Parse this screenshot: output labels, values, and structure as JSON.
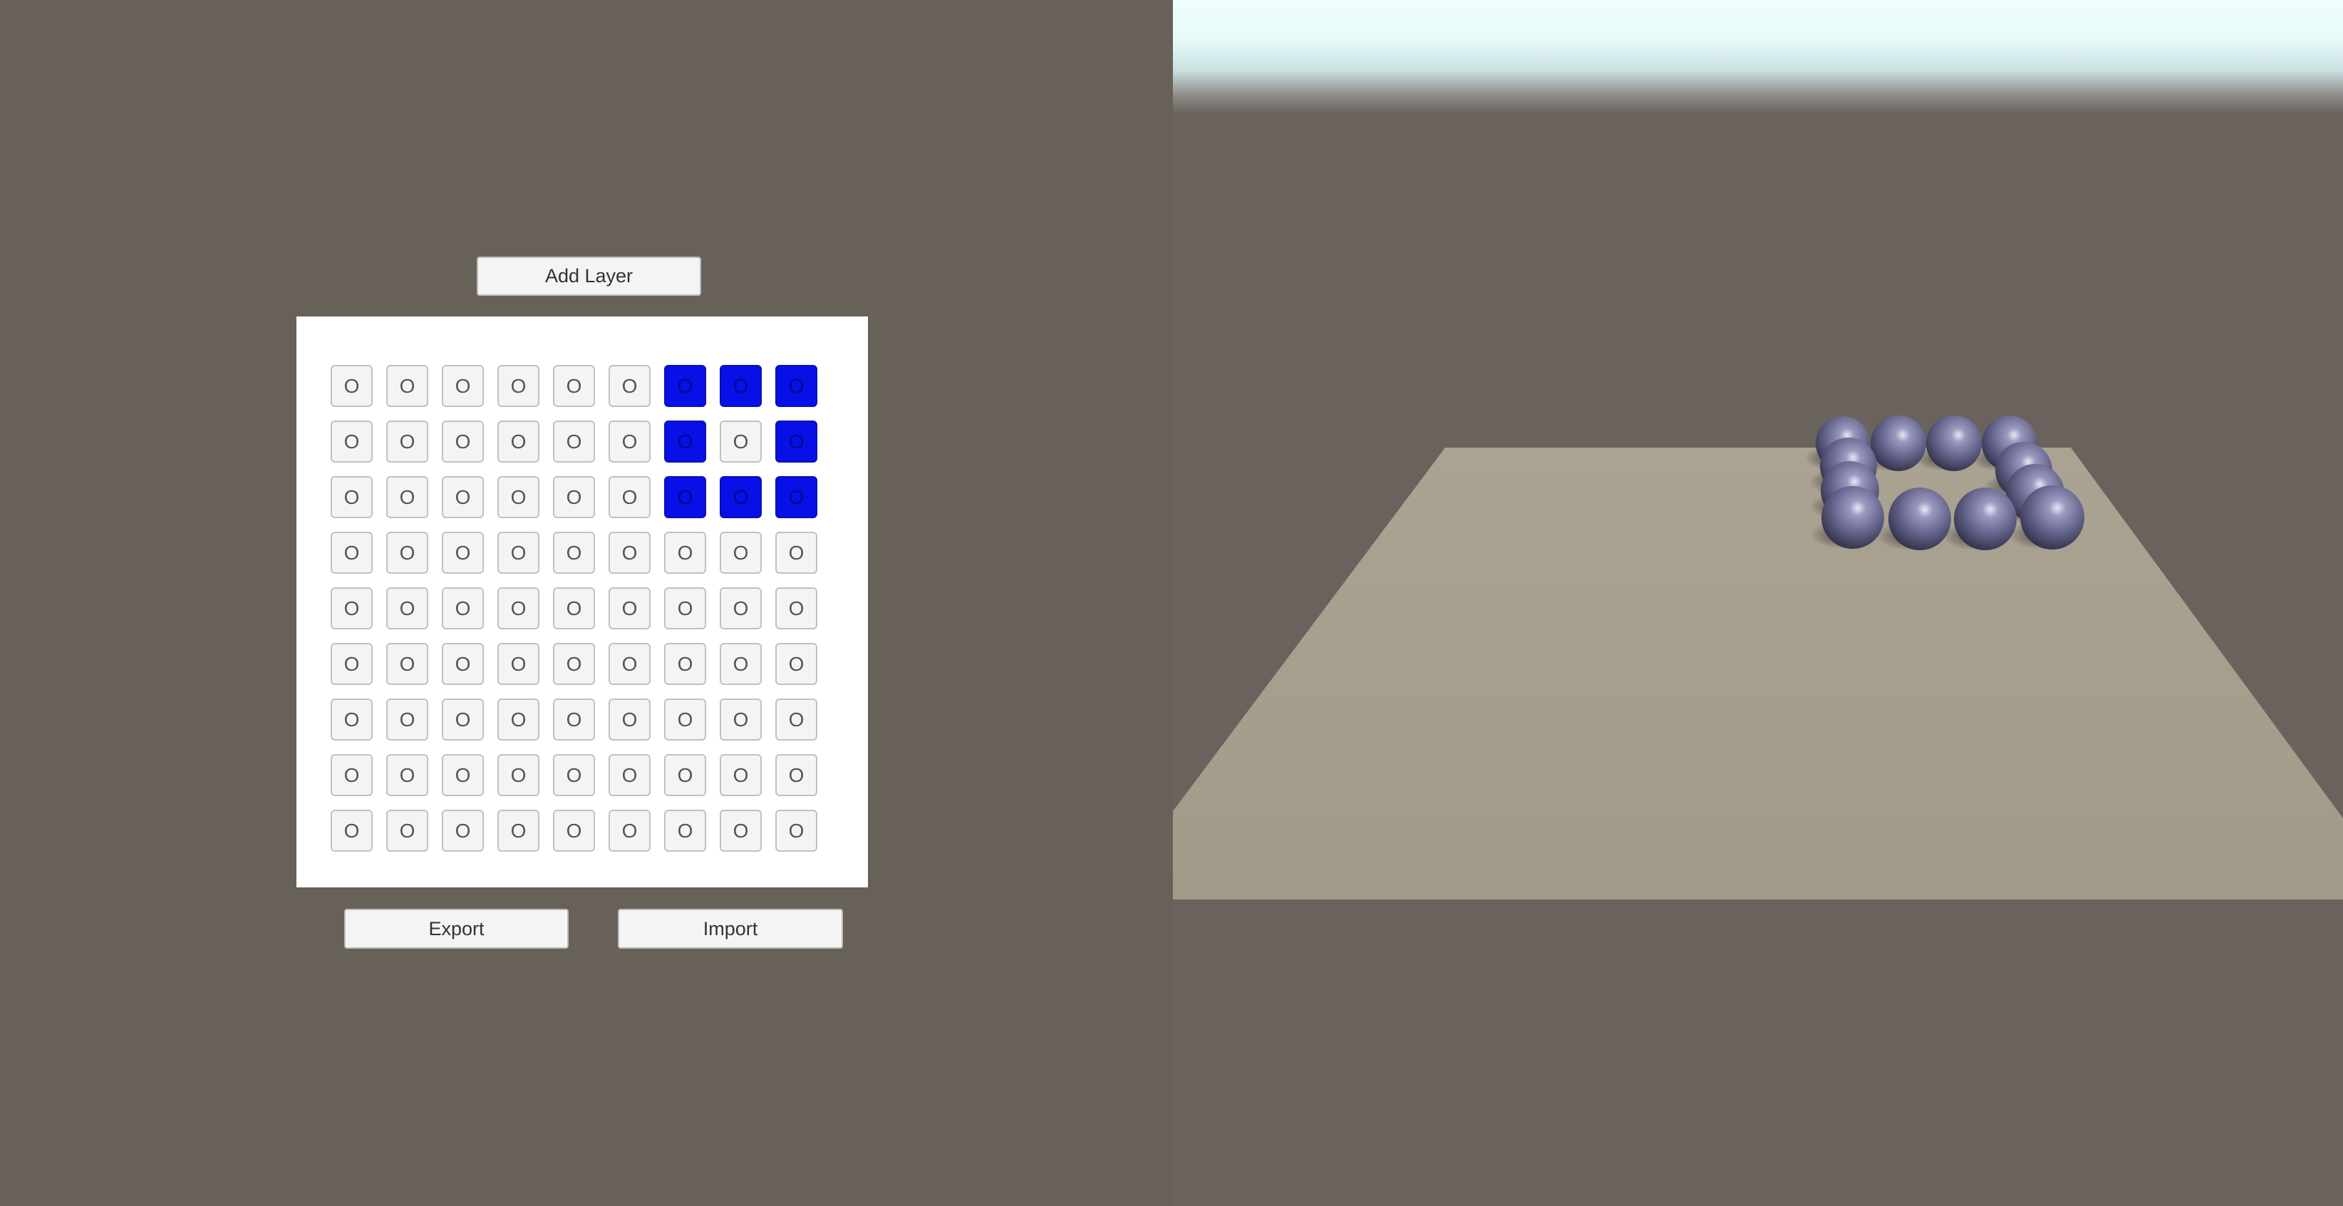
{
  "editor": {
    "add_layer_label": "Add Layer",
    "export_label": "Export",
    "import_label": "Import",
    "cell_glyph": "O",
    "rows": 9,
    "cols": 9,
    "active_color": "#0710e6",
    "active_cells": [
      [
        0,
        6
      ],
      [
        0,
        7
      ],
      [
        0,
        8
      ],
      [
        1,
        6
      ],
      [
        1,
        8
      ],
      [
        2,
        6
      ],
      [
        2,
        7
      ],
      [
        2,
        8
      ]
    ]
  },
  "viewport": {
    "floor_color": "#a59e8c",
    "background_color": "#686159",
    "sky_color": "#effefe",
    "sphere_color": "#6e6d94",
    "sphere_count": 12,
    "object": "sphere-ring"
  }
}
